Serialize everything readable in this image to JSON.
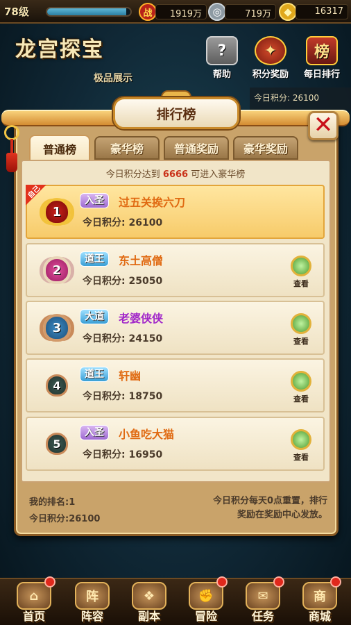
{
  "status_bar": {
    "level": "78级",
    "exp_fraction": 0.95,
    "power_icon": "战",
    "power": "1919万",
    "silver": "719万",
    "gold": "16317"
  },
  "background": {
    "game_title": "龙宫探宝",
    "help_label": "帮助",
    "points_reward_label": "积分奖励",
    "daily_rank_label": "每日排行",
    "showcase_label": "极品展示",
    "today_score": "今日积分: 26100"
  },
  "dialog": {
    "title": "排行榜",
    "close_symbol": "✕",
    "tabs": [
      "普通榜",
      "豪华榜",
      "普通奖励",
      "豪华奖励"
    ],
    "notice_prefix": "今日积分达到",
    "notice_value": "6666",
    "notice_suffix": "可进入豪华榜",
    "me_ribbon": "自己",
    "score_label": "今日积分:",
    "view_label": "查看",
    "rows": [
      {
        "rank": "1",
        "title": "入圣",
        "name": "过五关挨六刀",
        "score": "26100"
      },
      {
        "rank": "2",
        "title": "道王",
        "name": "东土高僧",
        "score": "25050"
      },
      {
        "rank": "3",
        "title": "大道",
        "name": "老婆侠侠",
        "score": "24150"
      },
      {
        "rank": "4",
        "title": "道王",
        "name": "轩幽",
        "score": "18750"
      },
      {
        "rank": "5",
        "title": "入圣",
        "name": "小鱼吃大猫",
        "score": "16950"
      }
    ],
    "my_rank": "我的排名:1",
    "my_score": "今日积分:26100",
    "reset_note_line1": "今日积分每天0点重置，排行",
    "reset_note_line2": "奖励在奖励中心发放。"
  },
  "bottom_nav": [
    {
      "label": "首页",
      "icon": "home-icon"
    },
    {
      "label": "阵容",
      "icon": "formation-icon",
      "glyph": "阵"
    },
    {
      "label": "副本",
      "icon": "dungeon-icon"
    },
    {
      "label": "冒险",
      "icon": "adventure-icon"
    },
    {
      "label": "任务",
      "icon": "quest-icon"
    },
    {
      "label": "商城",
      "icon": "shop-icon",
      "glyph": "商"
    }
  ],
  "colors": {
    "highlight_red": "#c9321a",
    "name_orange": "#e06a12",
    "name_purple": "#a126c9"
  }
}
